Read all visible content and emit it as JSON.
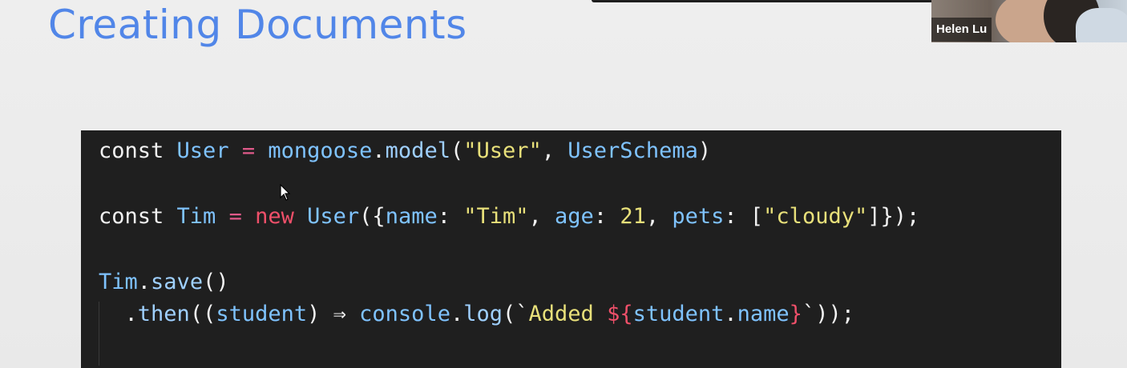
{
  "slide": {
    "title": "Creating Documents"
  },
  "participant": {
    "name": "Helen Lu"
  },
  "code": {
    "line1": [
      {
        "t": "const ",
        "c": "kw"
      },
      {
        "t": "User",
        "c": "id"
      },
      {
        "t": " = ",
        "c": "op"
      },
      {
        "t": "mongoose",
        "c": "id"
      },
      {
        "t": ".",
        "c": "punc"
      },
      {
        "t": "model",
        "c": "fn"
      },
      {
        "t": "(",
        "c": "punc"
      },
      {
        "t": "\"User\"",
        "c": "str"
      },
      {
        "t": ", ",
        "c": "punc"
      },
      {
        "t": "UserSchema",
        "c": "id"
      },
      {
        "t": ")",
        "c": "punc"
      }
    ],
    "line2": [
      {
        "t": "const ",
        "c": "kw"
      },
      {
        "t": "Tim",
        "c": "id"
      },
      {
        "t": " = ",
        "c": "op"
      },
      {
        "t": "new ",
        "c": "red"
      },
      {
        "t": "User",
        "c": "id"
      },
      {
        "t": "({",
        "c": "punc"
      },
      {
        "t": "name",
        "c": "id"
      },
      {
        "t": ": ",
        "c": "punc"
      },
      {
        "t": "\"Tim\"",
        "c": "str"
      },
      {
        "t": ", ",
        "c": "punc"
      },
      {
        "t": "age",
        "c": "id"
      },
      {
        "t": ": ",
        "c": "punc"
      },
      {
        "t": "21",
        "c": "str"
      },
      {
        "t": ", ",
        "c": "punc"
      },
      {
        "t": "pets",
        "c": "id"
      },
      {
        "t": ": [",
        "c": "punc"
      },
      {
        "t": "\"cloudy\"",
        "c": "str"
      },
      {
        "t": "]});",
        "c": "punc"
      }
    ],
    "line3": [
      {
        "t": "Tim",
        "c": "id"
      },
      {
        "t": ".",
        "c": "punc"
      },
      {
        "t": "save",
        "c": "fn"
      },
      {
        "t": "()",
        "c": "punc"
      }
    ],
    "line4": [
      {
        "t": "  .",
        "c": "punc"
      },
      {
        "t": "then",
        "c": "fn"
      },
      {
        "t": "((",
        "c": "punc"
      },
      {
        "t": "student",
        "c": "id"
      },
      {
        "t": ") ⇒ ",
        "c": "punc"
      },
      {
        "t": "console",
        "c": "id"
      },
      {
        "t": ".",
        "c": "punc"
      },
      {
        "t": "log",
        "c": "fn"
      },
      {
        "t": "(`",
        "c": "punc"
      },
      {
        "t": "Added ",
        "c": "str"
      },
      {
        "t": "${",
        "c": "red"
      },
      {
        "t": "student",
        "c": "id"
      },
      {
        "t": ".",
        "c": "punc"
      },
      {
        "t": "name",
        "c": "id"
      },
      {
        "t": "}",
        "c": "red"
      },
      {
        "t": "`));",
        "c": "punc"
      }
    ]
  }
}
